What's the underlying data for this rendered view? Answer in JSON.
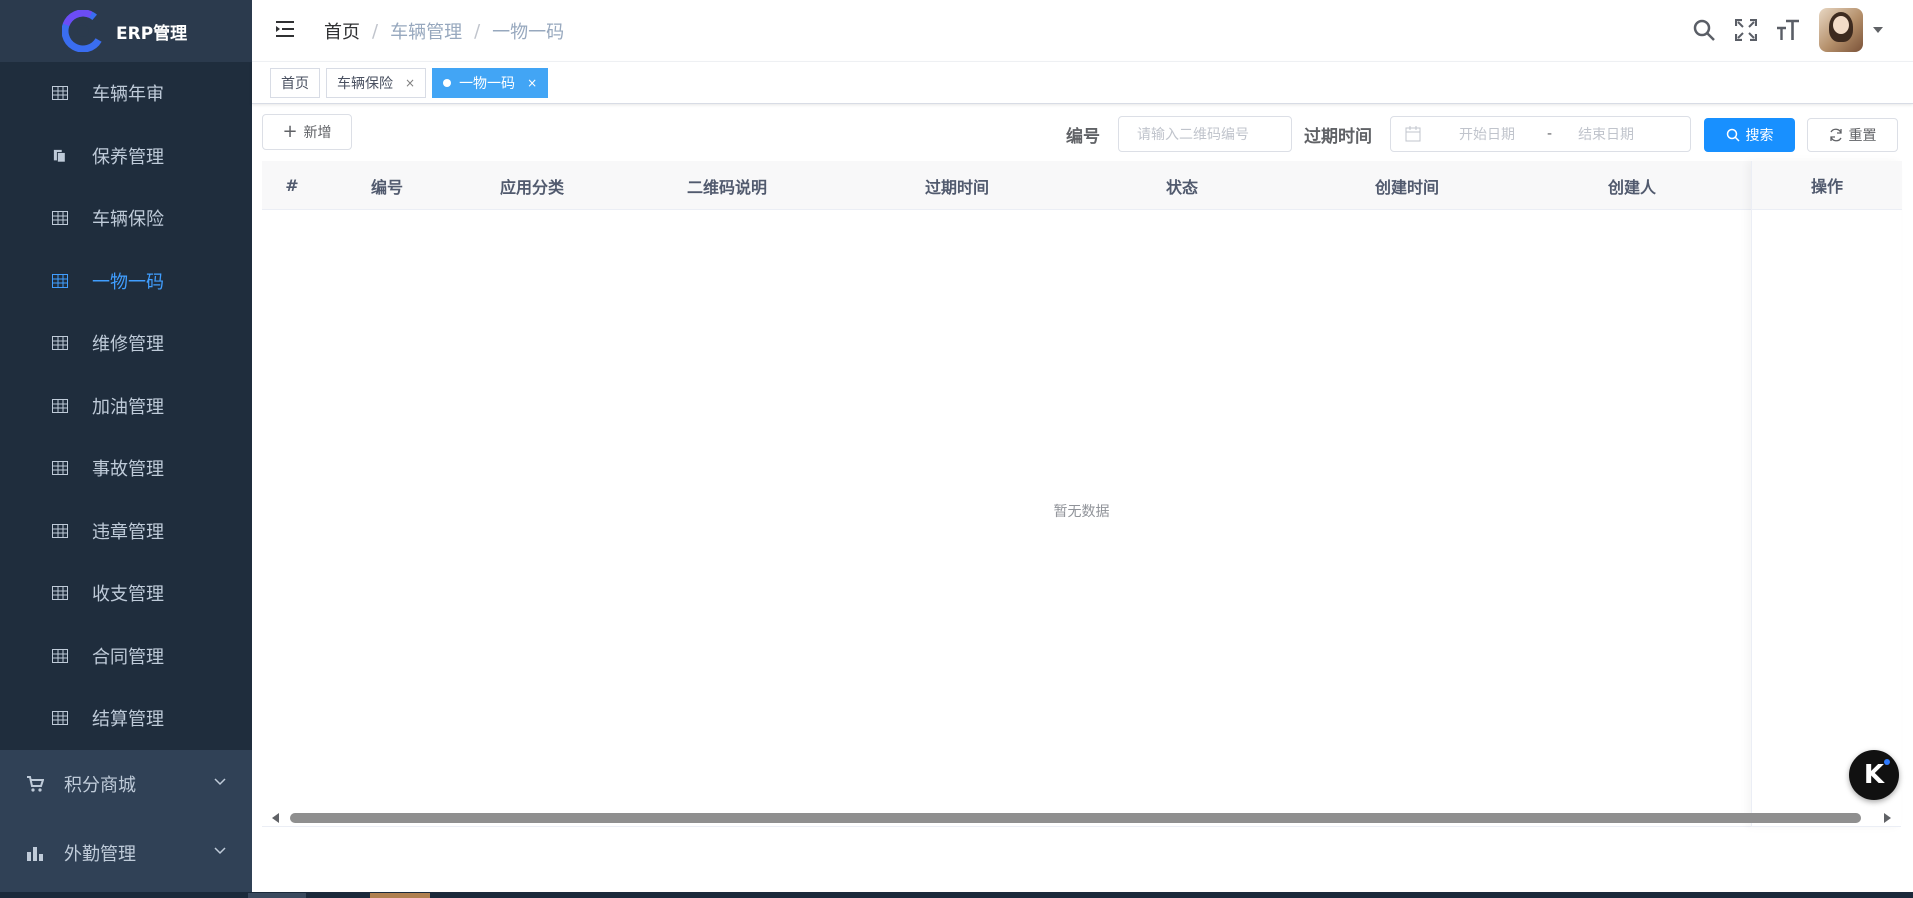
{
  "app": {
    "title": "ERP管理"
  },
  "sidebar": {
    "items": [
      {
        "label": "车辆年审",
        "active": false
      },
      {
        "label": "保养管理",
        "active": false
      },
      {
        "label": "车辆保险",
        "active": false
      },
      {
        "label": "一物一码",
        "active": true
      },
      {
        "label": "维修管理",
        "active": false
      },
      {
        "label": "加油管理",
        "active": false
      },
      {
        "label": "事故管理",
        "active": false
      },
      {
        "label": "违章管理",
        "active": false
      },
      {
        "label": "收支管理",
        "active": false
      },
      {
        "label": "合同管理",
        "active": false
      },
      {
        "label": "结算管理",
        "active": false
      }
    ],
    "groups": [
      {
        "label": "积分商城",
        "icon": "cart-icon"
      },
      {
        "label": "外勤管理",
        "icon": "bar-chart-icon"
      }
    ]
  },
  "breadcrumb": {
    "home": "首页",
    "level1": "车辆管理",
    "level2": "一物一码",
    "separator": "/"
  },
  "tags": {
    "home": "首页",
    "items": [
      {
        "label": "车辆保险",
        "close": "×"
      },
      {
        "label": "一物一码",
        "close": "×"
      }
    ]
  },
  "toolbar": {
    "add_label": "新增",
    "code_label": "编号",
    "code_placeholder": "请输入二维码编号",
    "expire_label": "过期时间",
    "start_placeholder": "开始日期",
    "range_separator": "-",
    "end_placeholder": "结束日期",
    "search_label": "搜索",
    "reset_label": "重置"
  },
  "table": {
    "columns": [
      "#",
      "编号",
      "应用分类",
      "二维码说明",
      "过期时间",
      "状态",
      "创建时间",
      "创建人"
    ],
    "action_column": "操作",
    "empty_text": "暂无数据",
    "rows": []
  },
  "colors": {
    "accent": "#409eff",
    "primary_button": "#1890ff",
    "active_tag": "#42a5f5",
    "sidebar_bg": "#304156",
    "submenu_bg": "#1f2d3d"
  }
}
